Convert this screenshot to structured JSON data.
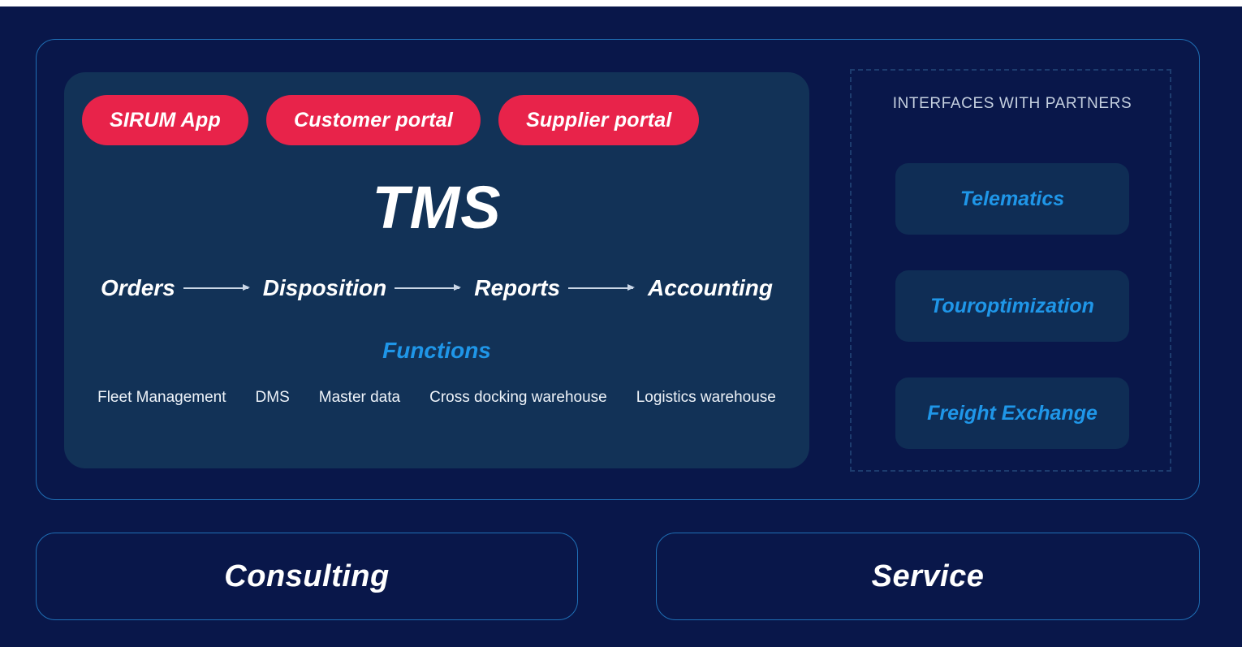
{
  "colors": {
    "page_background": "#09174a",
    "panel_background": "#123257",
    "card_background": "#0f2d55",
    "accent_red": "#e8234a",
    "accent_blue": "#1f96e8",
    "border_blue": "#1f6fb5",
    "dashed_border": "#1d3c6e",
    "text_white": "#ffffff",
    "text_muted": "#c5d0e0"
  },
  "core": {
    "title": "TMS",
    "portals": [
      {
        "label": "SIRUM App"
      },
      {
        "label": "Customer portal"
      },
      {
        "label": "Supplier portal"
      }
    ],
    "flow": [
      {
        "label": "Orders"
      },
      {
        "label": "Disposition"
      },
      {
        "label": "Reports"
      },
      {
        "label": "Accounting"
      }
    ],
    "functions_label": "Functions",
    "functions": [
      {
        "label": "Fleet Management"
      },
      {
        "label": "DMS"
      },
      {
        "label": "Master data"
      },
      {
        "label": "Cross docking warehouse"
      },
      {
        "label": "Logistics warehouse"
      }
    ]
  },
  "partners": {
    "title": "INTERFACES WITH PARTNERS",
    "items": [
      {
        "label": "Telematics"
      },
      {
        "label": "Touroptimization"
      },
      {
        "label": "Freight Exchange"
      }
    ]
  },
  "bottom": {
    "consulting": "Consulting",
    "service": "Service"
  }
}
